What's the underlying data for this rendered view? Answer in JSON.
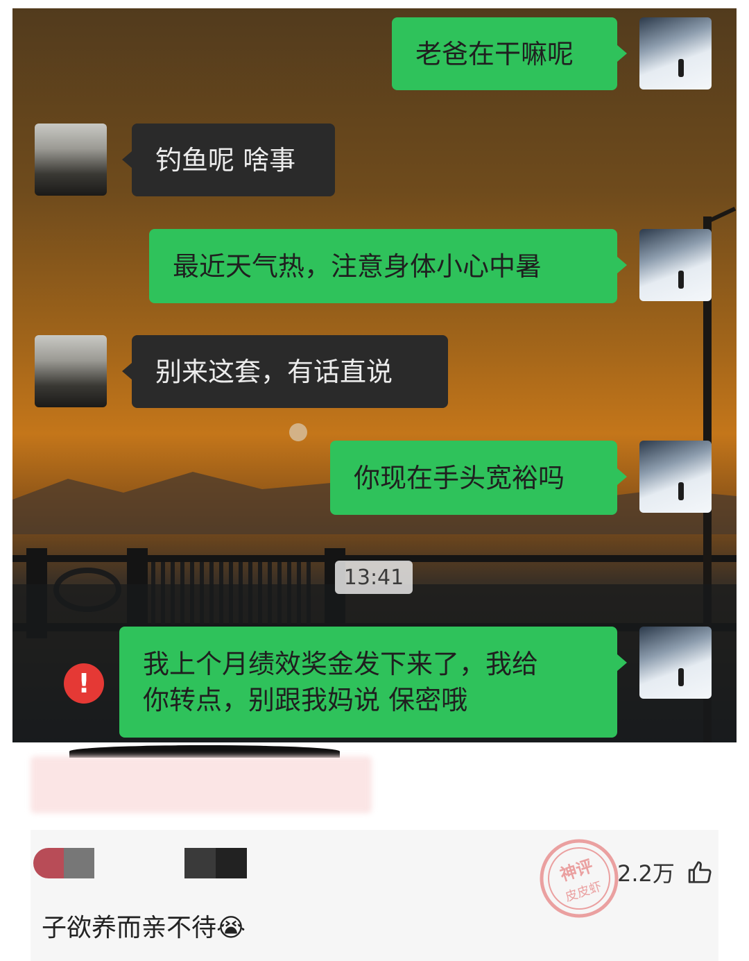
{
  "chat": {
    "messages": [
      {
        "sender": "me",
        "text": "老爸在干嘛呢"
      },
      {
        "sender": "dad",
        "text": "钓鱼呢 啥事"
      },
      {
        "sender": "me",
        "text": "最近天气热，注意身体小心中暑"
      },
      {
        "sender": "dad",
        "text": "别来这套，有话直说"
      },
      {
        "sender": "me",
        "text": "你现在手头宽裕吗"
      },
      {
        "sender": "me",
        "text_line1": "我上个月绩效奖金发下来了，我给",
        "text_line2": "你转点，别跟我妈说 保密哦",
        "status": "failed"
      }
    ],
    "timestamp": "13:41",
    "error_mark": "!",
    "bubble_colors": {
      "me": "#2fc25b",
      "dad": "#2a2a2a",
      "error": "#e53935"
    }
  },
  "comment": {
    "likes": "2.2万",
    "text": "子欲养而亲不待😭",
    "watermark": {
      "line1": "神评",
      "line2": "皮皮虾"
    },
    "icons": {
      "like": "thumbs-up-icon"
    }
  }
}
